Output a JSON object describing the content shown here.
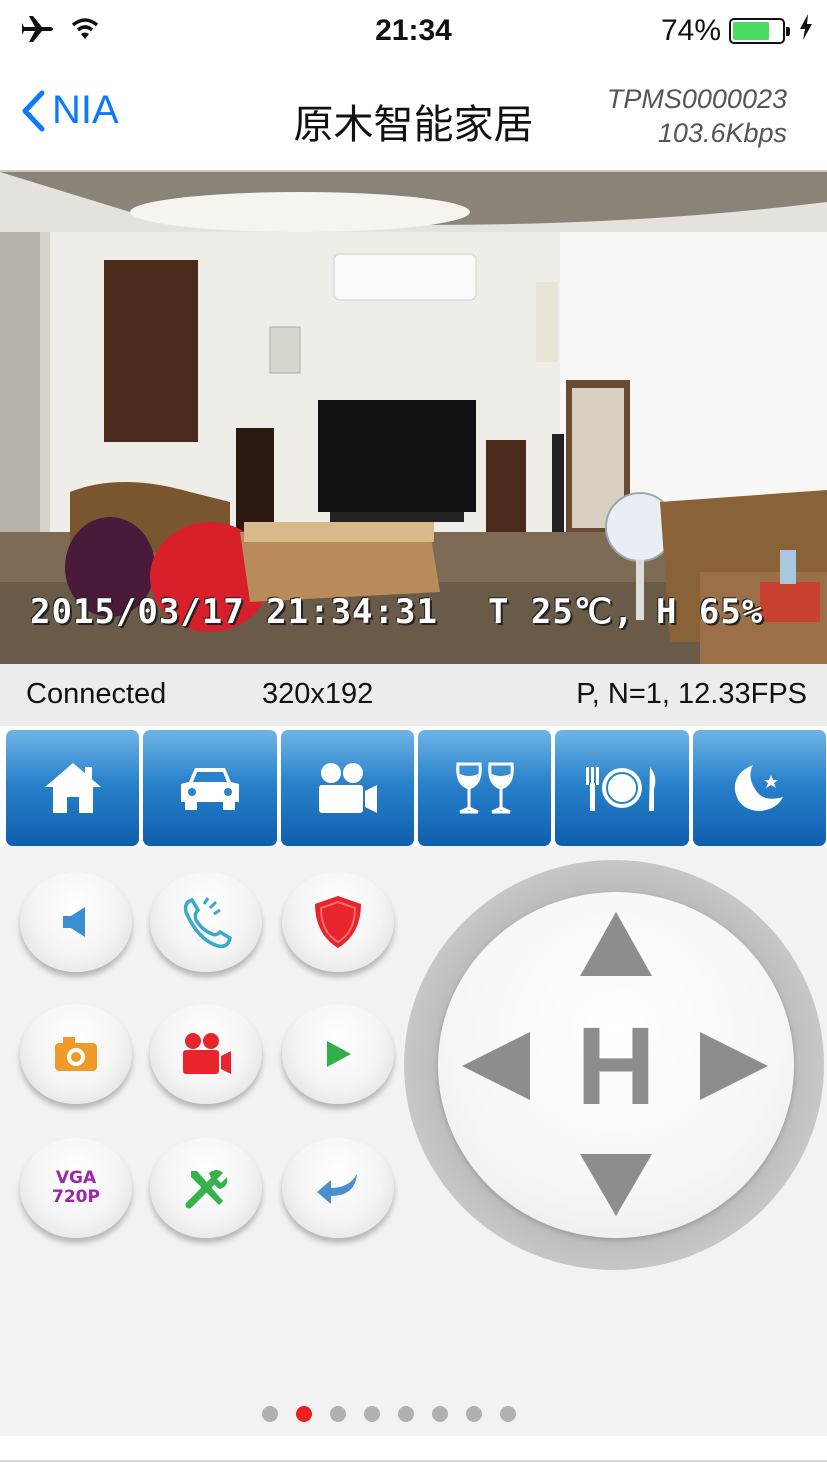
{
  "status_bar": {
    "time": "21:34",
    "battery_text": "74%",
    "battery_level": 0.74,
    "icons": [
      "airplane-icon",
      "wifi-icon",
      "battery-icon",
      "charging-icon"
    ]
  },
  "nav": {
    "back_label": "NIA",
    "title": "原木智能家居",
    "device_id": "TPMS0000023",
    "bitrate": "103.6Kbps"
  },
  "video": {
    "timestamp": "2015/03/17 21:34:31",
    "sensor": "T 25℃, H 65%"
  },
  "info_bar": {
    "status": "Connected",
    "resolution": "320x192",
    "stats": "P, N=1, 12.33FPS"
  },
  "scenes": [
    {
      "icon": "home-icon"
    },
    {
      "icon": "car-icon"
    },
    {
      "icon": "video-camera-icon"
    },
    {
      "icon": "wine-glasses-icon"
    },
    {
      "icon": "dining-icon"
    },
    {
      "icon": "moon-icon"
    }
  ],
  "controls": {
    "vga_line1": "VGA",
    "vga_line2": "720P",
    "joystick_center": "H"
  },
  "pager": {
    "count": 8,
    "active_index": 1
  },
  "colors": {
    "accent_blue": "#0a7aff",
    "scene_blue": "#2a82cb",
    "pager_active": "#f02020"
  }
}
